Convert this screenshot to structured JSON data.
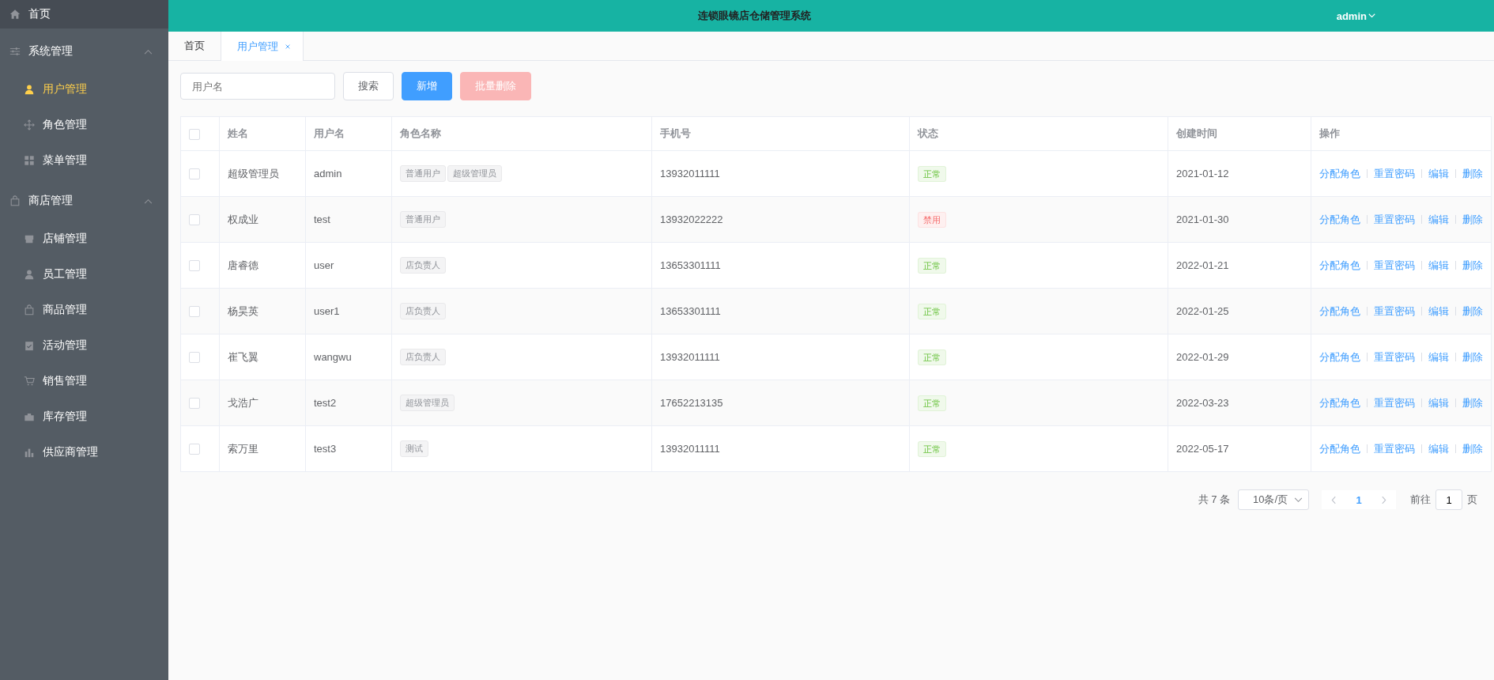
{
  "sidebar": {
    "home": {
      "label": "首页",
      "selected": false
    },
    "groups": [
      {
        "label": "系统管理",
        "expanded": true,
        "items": [
          {
            "label": "用户管理",
            "selected": true
          },
          {
            "label": "角色管理",
            "selected": false
          },
          {
            "label": "菜单管理",
            "selected": false
          }
        ]
      },
      {
        "label": "商店管理",
        "expanded": true,
        "items": [
          {
            "label": "店铺管理",
            "selected": false
          },
          {
            "label": "员工管理",
            "selected": false
          },
          {
            "label": "商品管理",
            "selected": false
          },
          {
            "label": "活动管理",
            "selected": false
          },
          {
            "label": "销售管理",
            "selected": false
          },
          {
            "label": "库存管理",
            "selected": false
          },
          {
            "label": "供应商管理",
            "selected": false
          }
        ]
      }
    ]
  },
  "header": {
    "title": "连锁眼镜店仓储管理系统",
    "user": "admin"
  },
  "tabs": [
    {
      "label": "首页",
      "selected": false,
      "closable": false
    },
    {
      "label": "用户管理",
      "selected": true,
      "closable": true
    }
  ],
  "search": {
    "placeholder": "用户名"
  },
  "buttons": [
    {
      "label": "搜索",
      "kind": "default",
      "disabled": false
    },
    {
      "label": "新增",
      "kind": "primary",
      "disabled": false
    },
    {
      "label": "批量删除",
      "kind": "danger",
      "disabled": true
    }
  ],
  "table": {
    "select_all": {
      "checked": false
    },
    "columns": [
      "姓名",
      "用户名",
      "角色名称",
      "手机号",
      "状态",
      "创建时间",
      "操作"
    ],
    "rows": [
      {
        "checked": false,
        "name": "超级管理员",
        "username": "admin",
        "roles": [
          "普通用户",
          "超级管理员"
        ],
        "phone": "13932011111",
        "status": {
          "label": "正常",
          "kind": "success"
        },
        "created": "2021-01-12",
        "actions": [
          "分配角色",
          "重置密码",
          "编辑",
          "删除"
        ]
      },
      {
        "checked": false,
        "name": "权成业",
        "username": "test",
        "roles": [
          "普通用户"
        ],
        "phone": "13932022222",
        "status": {
          "label": "禁用",
          "kind": "danger"
        },
        "created": "2021-01-30",
        "actions": [
          "分配角色",
          "重置密码",
          "编辑",
          "删除"
        ]
      },
      {
        "checked": false,
        "name": "唐睿德",
        "username": "user",
        "roles": [
          "店负责人"
        ],
        "phone": "13653301111",
        "status": {
          "label": "正常",
          "kind": "success"
        },
        "created": "2022-01-21",
        "actions": [
          "分配角色",
          "重置密码",
          "编辑",
          "删除"
        ]
      },
      {
        "checked": false,
        "name": "杨昊英",
        "username": "user1",
        "roles": [
          "店负责人"
        ],
        "phone": "13653301111",
        "status": {
          "label": "正常",
          "kind": "success"
        },
        "created": "2022-01-25",
        "actions": [
          "分配角色",
          "重置密码",
          "编辑",
          "删除"
        ]
      },
      {
        "checked": false,
        "name": "崔飞翼",
        "username": "wangwu",
        "roles": [
          "店负责人"
        ],
        "phone": "13932011111",
        "status": {
          "label": "正常",
          "kind": "success"
        },
        "created": "2022-01-29",
        "actions": [
          "分配角色",
          "重置密码",
          "编辑",
          "删除"
        ]
      },
      {
        "checked": false,
        "name": "戈浩广",
        "username": "test2",
        "roles": [
          "超级管理员"
        ],
        "phone": "17652213135",
        "status": {
          "label": "正常",
          "kind": "success"
        },
        "created": "2022-03-23",
        "actions": [
          "分配角色",
          "重置密码",
          "编辑",
          "删除"
        ]
      },
      {
        "checked": false,
        "name": "索万里",
        "username": "test3",
        "roles": [
          "测试"
        ],
        "phone": "13932011111",
        "status": {
          "label": "正常",
          "kind": "success"
        },
        "created": "2022-05-17",
        "actions": [
          "分配角色",
          "重置密码",
          "编辑",
          "删除"
        ]
      }
    ]
  },
  "pagination": {
    "total": "共 7 条",
    "page_size": "10条/页",
    "pages": [
      {
        "label": "1",
        "selected": true
      }
    ],
    "goto_label": "前往",
    "goto_value": "1",
    "goto_suffix": "页"
  }
}
